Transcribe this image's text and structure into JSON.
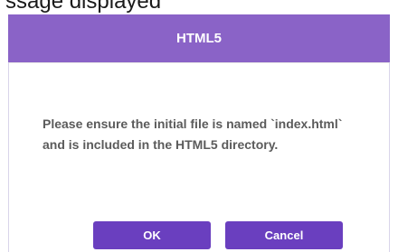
{
  "background": {
    "text": "ssage displayed"
  },
  "dialog": {
    "title": "HTML5",
    "message": "Please ensure the initial file is named `index.html` and is included in the HTML5 directory.",
    "ok_label": "OK",
    "cancel_label": "Cancel"
  },
  "colors": {
    "header": "#8a63c7",
    "button": "#6a3fbf",
    "message_text": "#5b5b5b"
  }
}
